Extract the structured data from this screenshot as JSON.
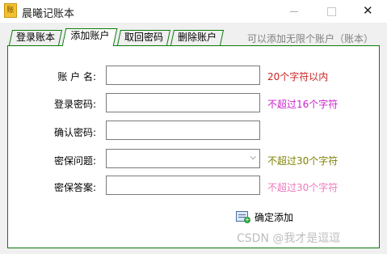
{
  "window": {
    "title": "晨曦记账本",
    "icon": "ledger-app-icon",
    "icon_glyph": "账",
    "close_glyph": "✕"
  },
  "tabs": [
    {
      "label": "登录账本",
      "active": false
    },
    {
      "label": "添加账户",
      "active": true
    },
    {
      "label": "取回密码",
      "active": false
    },
    {
      "label": "删除账户",
      "active": false
    }
  ],
  "tab_hint": "可以添加无限个账户（账本）",
  "form": {
    "account_label": "账 户 名:",
    "account_value": "",
    "account_hint": "20个字符以内",
    "password_label": "登录密码:",
    "password_value": "",
    "password_hint": "不超过16个字符",
    "confirm_label": "确认密码:",
    "confirm_value": "",
    "question_label": "密保问题:",
    "question_value": "",
    "question_arrow": "⌵",
    "question_hint": "不超过30个字符",
    "answer_label": "密保答案:",
    "answer_value": "",
    "answer_hint": "不超过30个字符",
    "submit_label": "确定添加",
    "submit_icon": "add-record-icon",
    "submit_plus": "+"
  },
  "watermark": "CSDN @我才是逗逗",
  "colors": {
    "tab_border": "#0b7a0b",
    "hint_account": "#cc2222",
    "hint_password": "#cc22cc",
    "hint_question": "#808000",
    "hint_answer": "#ee77bb",
    "watermark": "#bdbdbd"
  }
}
